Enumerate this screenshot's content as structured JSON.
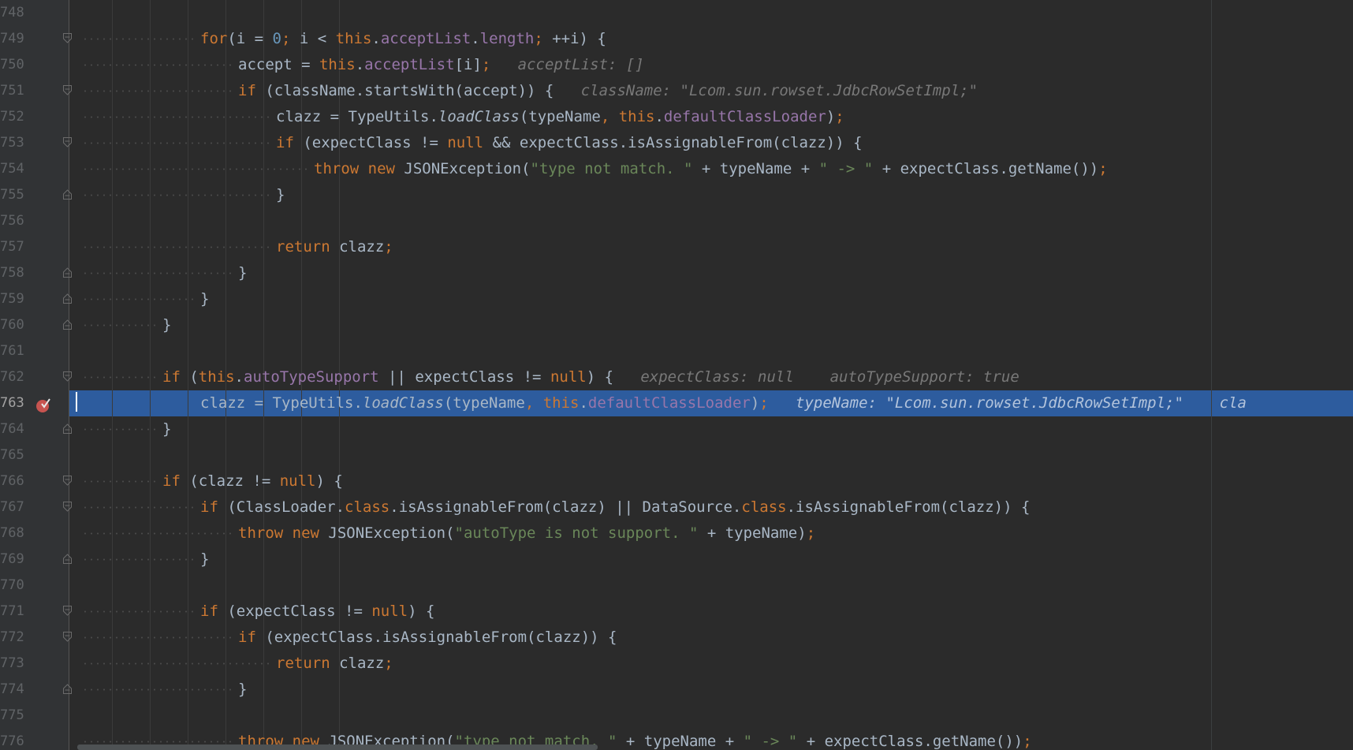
{
  "editor": {
    "theme_colors": {
      "background": "#2b2b2b",
      "current_line": "#2d5c9e",
      "keyword": "#cc7832",
      "field": "#9876aa",
      "string": "#6a8759",
      "number": "#6897bb",
      "hint": "#787878"
    },
    "breakpoint_icon": "breakpoint-verified-icon",
    "fold_icon": "fold-marker-icon",
    "lines": [
      {
        "n": "748",
        "indent": 0,
        "fold": "none",
        "tokens": []
      },
      {
        "n": "749",
        "indent": 3,
        "fold": "open",
        "tokens": [
          {
            "t": "for",
            "c": "kw"
          },
          {
            "t": "(i = "
          },
          {
            "t": "0",
            "c": "num"
          },
          {
            "t": "; ",
            "c": "kw"
          },
          {
            "t": "i < "
          },
          {
            "t": "this",
            "c": "kw"
          },
          {
            "t": "."
          },
          {
            "t": "acceptList",
            "c": "fld"
          },
          {
            "t": "."
          },
          {
            "t": "length",
            "c": "fld"
          },
          {
            "t": "; ",
            "c": "kw"
          },
          {
            "t": "++i) {"
          }
        ]
      },
      {
        "n": "750",
        "indent": 4,
        "fold": "none",
        "tokens": [
          {
            "t": "accept = "
          },
          {
            "t": "this",
            "c": "kw"
          },
          {
            "t": "."
          },
          {
            "t": "acceptList",
            "c": "fld"
          },
          {
            "t": "[i]"
          },
          {
            "t": ";",
            "c": "kw"
          },
          {
            "t": "   acceptList: []",
            "c": "hint"
          }
        ]
      },
      {
        "n": "751",
        "indent": 4,
        "fold": "open",
        "tokens": [
          {
            "t": "if ",
            "c": "kw"
          },
          {
            "t": "(className.startsWith(accept)) {"
          },
          {
            "t": "   className: \"Lcom.sun.rowset.JdbcRowSetImpl;\"",
            "c": "hint"
          }
        ]
      },
      {
        "n": "752",
        "indent": 5,
        "fold": "none",
        "tokens": [
          {
            "t": "clazz = TypeUtils."
          },
          {
            "t": "loadClass",
            "c": "mth"
          },
          {
            "t": "(typeName"
          },
          {
            "t": ", ",
            "c": "kw"
          },
          {
            "t": "this",
            "c": "kw"
          },
          {
            "t": "."
          },
          {
            "t": "defaultClassLoader",
            "c": "fld"
          },
          {
            "t": ")"
          },
          {
            "t": ";",
            "c": "kw"
          }
        ]
      },
      {
        "n": "753",
        "indent": 5,
        "fold": "open",
        "tokens": [
          {
            "t": "if ",
            "c": "kw"
          },
          {
            "t": "(expectClass != "
          },
          {
            "t": "null",
            "c": "kw"
          },
          {
            "t": " && expectClass.isAssignableFrom(clazz)) {"
          }
        ]
      },
      {
        "n": "754",
        "indent": 6,
        "fold": "none",
        "tokens": [
          {
            "t": "throw new ",
            "c": "kw"
          },
          {
            "t": "JSONException("
          },
          {
            "t": "\"type not match. \"",
            "c": "str"
          },
          {
            "t": " + typeName + "
          },
          {
            "t": "\" -> \"",
            "c": "str"
          },
          {
            "t": " + expectClass.getName())"
          },
          {
            "t": ";",
            "c": "kw"
          }
        ]
      },
      {
        "n": "755",
        "indent": 5,
        "fold": "close",
        "tokens": [
          {
            "t": "}"
          }
        ]
      },
      {
        "n": "756",
        "indent": 0,
        "fold": "none",
        "tokens": []
      },
      {
        "n": "757",
        "indent": 5,
        "fold": "none",
        "tokens": [
          {
            "t": "return ",
            "c": "kw"
          },
          {
            "t": "clazz"
          },
          {
            "t": ";",
            "c": "kw"
          }
        ]
      },
      {
        "n": "758",
        "indent": 4,
        "fold": "close",
        "tokens": [
          {
            "t": "}"
          }
        ]
      },
      {
        "n": "759",
        "indent": 3,
        "fold": "close",
        "tokens": [
          {
            "t": "}"
          }
        ]
      },
      {
        "n": "760",
        "indent": 2,
        "fold": "close",
        "tokens": [
          {
            "t": "}"
          }
        ]
      },
      {
        "n": "761",
        "indent": 0,
        "fold": "none",
        "tokens": []
      },
      {
        "n": "762",
        "indent": 2,
        "fold": "open",
        "tokens": [
          {
            "t": "if ",
            "c": "kw"
          },
          {
            "t": "("
          },
          {
            "t": "this",
            "c": "kw"
          },
          {
            "t": "."
          },
          {
            "t": "autoTypeSupport",
            "c": "fld"
          },
          {
            "t": " || expectClass != "
          },
          {
            "t": "null",
            "c": "kw"
          },
          {
            "t": ") {"
          },
          {
            "t": "   expectClass: null    autoTypeSupport: true",
            "c": "hint"
          }
        ]
      },
      {
        "n": "763",
        "indent": 3,
        "fold": "none",
        "current": true,
        "breakpoint": true,
        "tokens": [
          {
            "t": "clazz = TypeUtils."
          },
          {
            "t": "loadClass",
            "c": "mth"
          },
          {
            "t": "(typeName"
          },
          {
            "t": ", ",
            "c": "kw"
          },
          {
            "t": "this",
            "c": "kw"
          },
          {
            "t": "."
          },
          {
            "t": "defaultClassLoader",
            "c": "fld"
          },
          {
            "t": ")"
          },
          {
            "t": ";",
            "c": "kw"
          },
          {
            "t": "   typeName: \"Lcom.sun.rowset.JdbcRowSetImpl;\"    cla",
            "c": "hint"
          }
        ]
      },
      {
        "n": "764",
        "indent": 2,
        "fold": "close",
        "tokens": [
          {
            "t": "}"
          }
        ]
      },
      {
        "n": "765",
        "indent": 0,
        "fold": "none",
        "tokens": []
      },
      {
        "n": "766",
        "indent": 2,
        "fold": "open",
        "tokens": [
          {
            "t": "if ",
            "c": "kw"
          },
          {
            "t": "(clazz != "
          },
          {
            "t": "null",
            "c": "kw"
          },
          {
            "t": ") {"
          }
        ]
      },
      {
        "n": "767",
        "indent": 3,
        "fold": "open",
        "tokens": [
          {
            "t": "if ",
            "c": "kw"
          },
          {
            "t": "(ClassLoader."
          },
          {
            "t": "class",
            "c": "kw"
          },
          {
            "t": ".isAssignableFrom(clazz) || DataSource."
          },
          {
            "t": "class",
            "c": "kw"
          },
          {
            "t": ".isAssignableFrom(clazz)) {"
          }
        ]
      },
      {
        "n": "768",
        "indent": 4,
        "fold": "none",
        "tokens": [
          {
            "t": "throw new ",
            "c": "kw"
          },
          {
            "t": "JSONException("
          },
          {
            "t": "\"autoType is not support. \"",
            "c": "str"
          },
          {
            "t": " + typeName)"
          },
          {
            "t": ";",
            "c": "kw"
          }
        ]
      },
      {
        "n": "769",
        "indent": 3,
        "fold": "close",
        "tokens": [
          {
            "t": "}"
          }
        ]
      },
      {
        "n": "770",
        "indent": 0,
        "fold": "none",
        "tokens": []
      },
      {
        "n": "771",
        "indent": 3,
        "fold": "open",
        "tokens": [
          {
            "t": "if ",
            "c": "kw"
          },
          {
            "t": "(expectClass != "
          },
          {
            "t": "null",
            "c": "kw"
          },
          {
            "t": ") {"
          }
        ]
      },
      {
        "n": "772",
        "indent": 4,
        "fold": "open",
        "tokens": [
          {
            "t": "if ",
            "c": "kw"
          },
          {
            "t": "(expectClass.isAssignableFrom(clazz)) {"
          }
        ]
      },
      {
        "n": "773",
        "indent": 5,
        "fold": "none",
        "tokens": [
          {
            "t": "return ",
            "c": "kw"
          },
          {
            "t": "clazz"
          },
          {
            "t": ";",
            "c": "kw"
          }
        ]
      },
      {
        "n": "774",
        "indent": 4,
        "fold": "close",
        "tokens": [
          {
            "t": "}"
          }
        ]
      },
      {
        "n": "775",
        "indent": 0,
        "fold": "none",
        "tokens": []
      },
      {
        "n": "776",
        "indent": 4,
        "fold": "none",
        "tokens": [
          {
            "t": "throw new ",
            "c": "kw"
          },
          {
            "t": "JSONException("
          },
          {
            "t": "\"type not match. \"",
            "c": "str"
          },
          {
            "t": " + typeName + "
          },
          {
            "t": "\" -> \"",
            "c": "str"
          },
          {
            "t": " + expectClass.getName())"
          },
          {
            "t": ";",
            "c": "kw"
          }
        ]
      }
    ]
  }
}
